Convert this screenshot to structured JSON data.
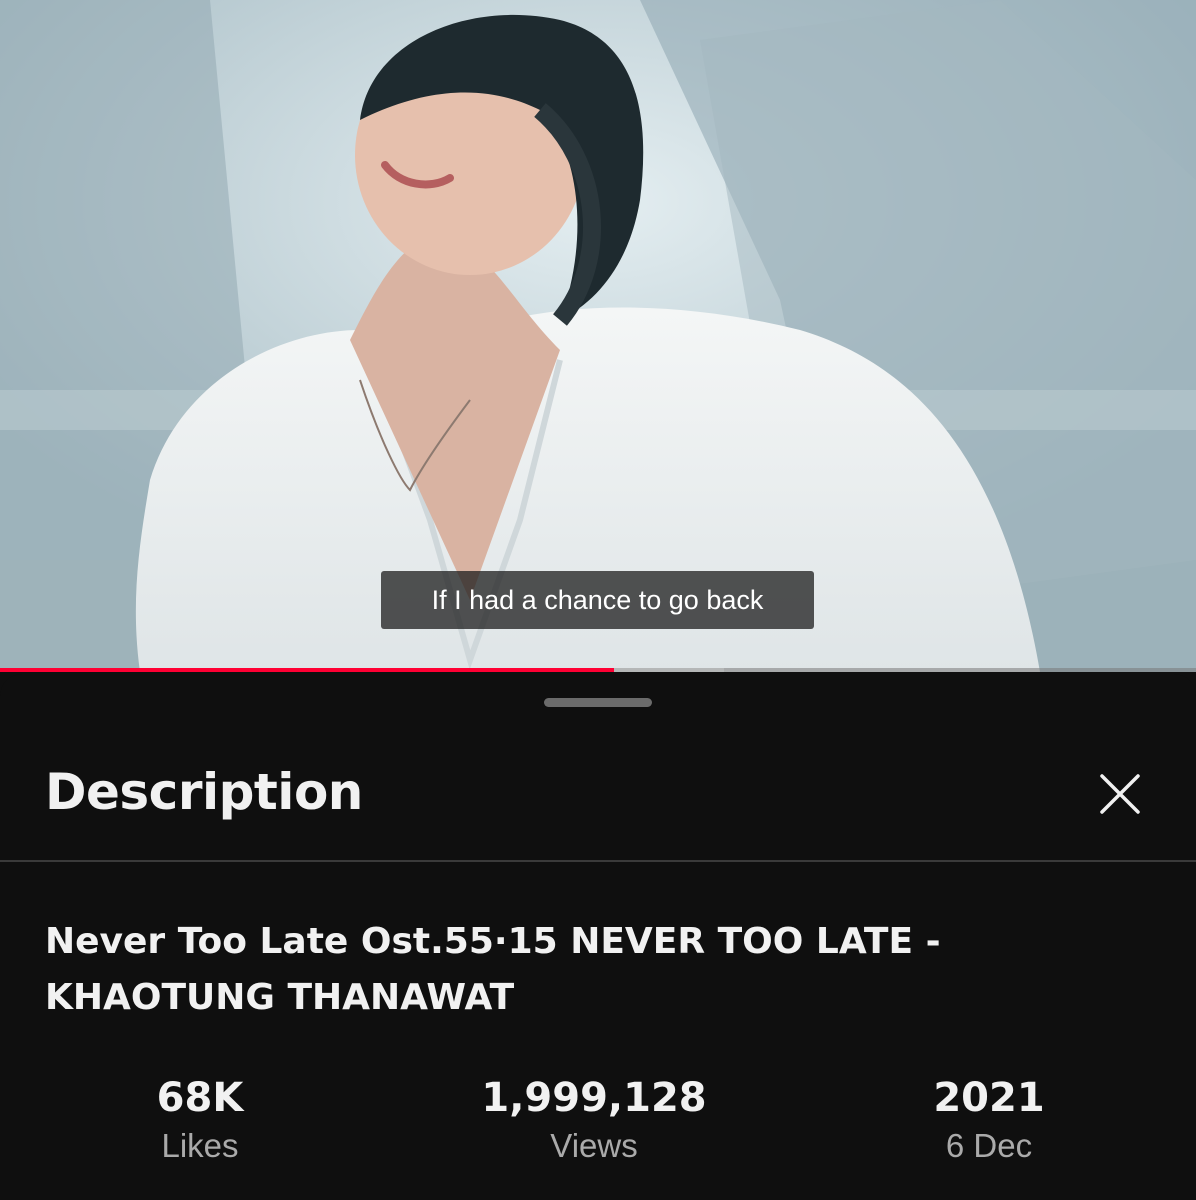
{
  "video": {
    "subtitle": "If I had a chance to go back",
    "progress_fraction": 0.513,
    "buffered_fraction": 0.605,
    "accent_color": "#ff0033"
  },
  "description_sheet": {
    "title": "Description",
    "close_icon": "close-icon",
    "video_title_line1": "Never Too Late Ost.55·15 NEVER TOO LATE -",
    "video_title_line2": "KHAOTUNG THANAWAT",
    "stats": {
      "likes": {
        "value": "68K",
        "label": "Likes"
      },
      "views": {
        "value": "1,999,128",
        "label": "Views"
      },
      "date": {
        "value": "2021",
        "label": "6 Dec"
      }
    }
  }
}
